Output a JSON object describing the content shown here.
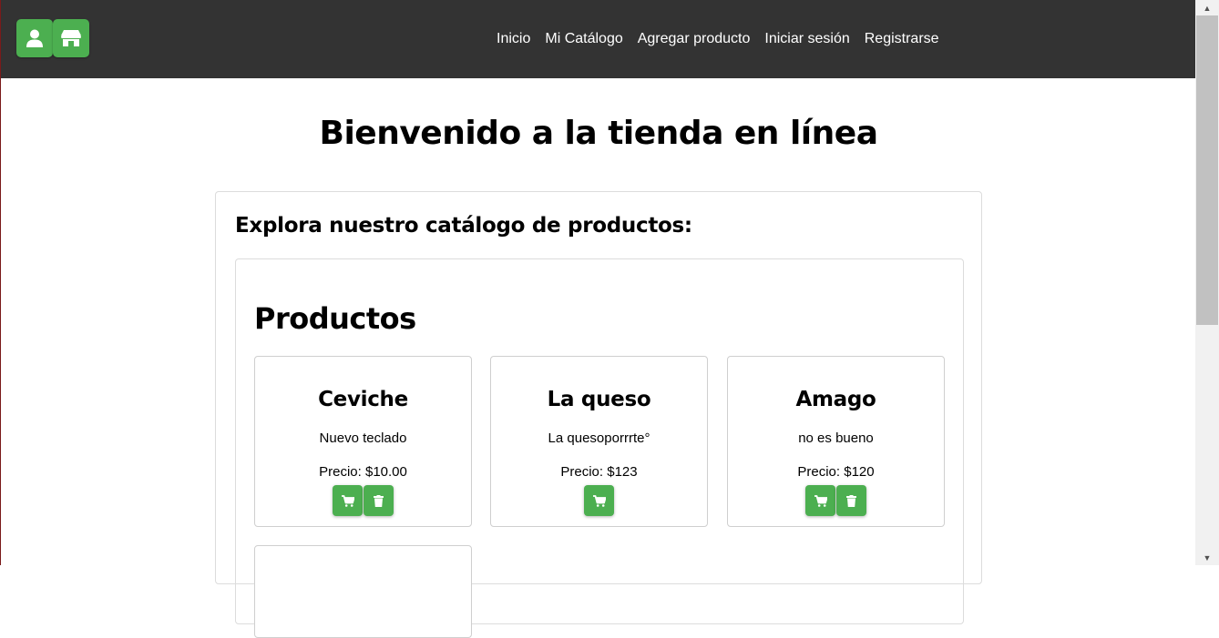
{
  "colors": {
    "navbar": "#333333",
    "accent": "#4caf50",
    "text": "#000000"
  },
  "navbar": {
    "icons": [
      "user-icon",
      "store-icon"
    ],
    "links": [
      {
        "label": "Inicio"
      },
      {
        "label": "Mi Catálogo"
      },
      {
        "label": "Agregar producto"
      },
      {
        "label": "Iniciar sesión"
      },
      {
        "label": "Registrarse"
      }
    ]
  },
  "page": {
    "title": "Bienvenido a la tienda en línea",
    "catalog_heading": "Explora nuestro catálogo de productos:",
    "products_heading": "Productos"
  },
  "products": [
    {
      "name": "Ceviche",
      "description": "Nuevo teclado",
      "price": "Precio: $10.00",
      "actions": [
        "cart-icon",
        "trash-icon"
      ]
    },
    {
      "name": "La queso",
      "description": "La quesoporrrte°",
      "price": "Precio: $123",
      "actions": [
        "cart-icon"
      ]
    },
    {
      "name": "Amago",
      "description": "no es bueno",
      "price": "Precio: $120",
      "actions": [
        "cart-icon",
        "trash-icon"
      ]
    }
  ]
}
